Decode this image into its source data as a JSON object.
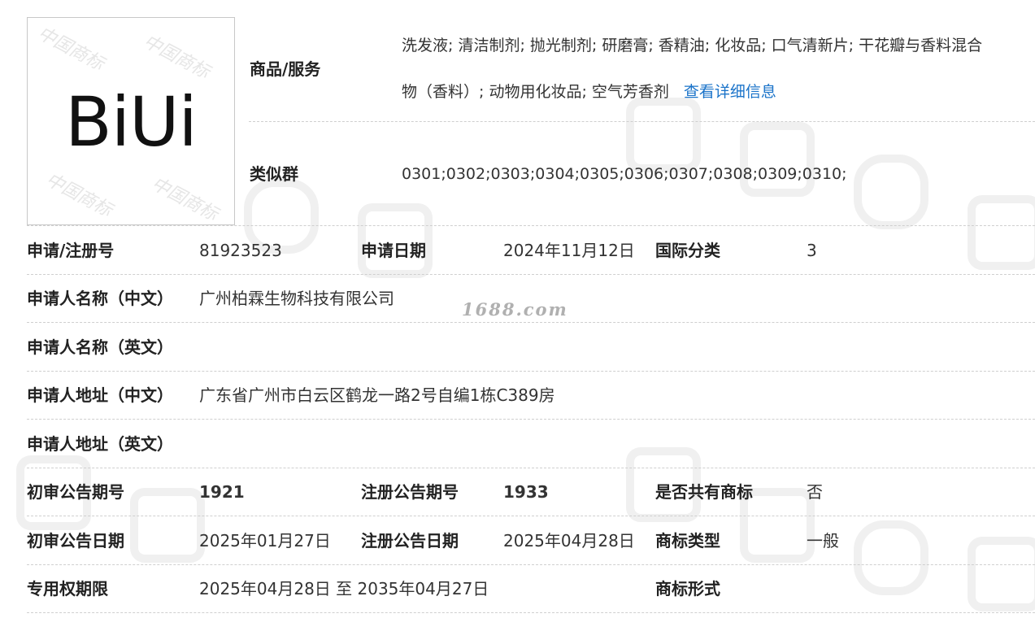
{
  "logo": {
    "text": "BiUi",
    "watermark": "中国商标"
  },
  "watermark_text": "1688.com",
  "goods": {
    "label": "商品/服务",
    "line1": "洗发液; 清洁制剂; 抛光制剂; 研磨膏; 香精油; 化妆品; 口气清新片; 干花瓣与香料混合",
    "line2": "物（香料）; 动物用化妆品; 空气芳香剂",
    "more_link": "查看详细信息"
  },
  "similar": {
    "label": "类似群",
    "value": "0301;0302;0303;0304;0305;0306;0307;0308;0309;0310;"
  },
  "rows": {
    "reg_no": {
      "label": "申请/注册号",
      "value": "81923523"
    },
    "app_date": {
      "label": "申请日期",
      "value": "2024年11月12日"
    },
    "intl_class": {
      "label": "国际分类",
      "value": "3"
    },
    "name_cn": {
      "label": "申请人名称（中文）",
      "value": "广州柏霖生物科技有限公司"
    },
    "name_en": {
      "label": "申请人名称（英文）",
      "value": ""
    },
    "addr_cn": {
      "label": "申请人地址（中文）",
      "value": "广东省广州市白云区鹤龙一路2号自编1栋C389房"
    },
    "addr_en": {
      "label": "申请人地址（英文）",
      "value": ""
    },
    "prelim_issue": {
      "label": "初审公告期号",
      "value": "1921"
    },
    "reg_issue": {
      "label": "注册公告期号",
      "value": "1933"
    },
    "shared": {
      "label": "是否共有商标",
      "value": "否"
    },
    "prelim_date": {
      "label": "初审公告日期",
      "value": "2025年01月27日"
    },
    "reg_date": {
      "label": "注册公告日期",
      "value": "2025年04月28日"
    },
    "tm_type": {
      "label": "商标类型",
      "value": "一般"
    },
    "term": {
      "label": "专用权期限",
      "value": "2025年04月28日 至 2035年04月27日"
    },
    "tm_form": {
      "label": "商标形式",
      "value": ""
    }
  }
}
